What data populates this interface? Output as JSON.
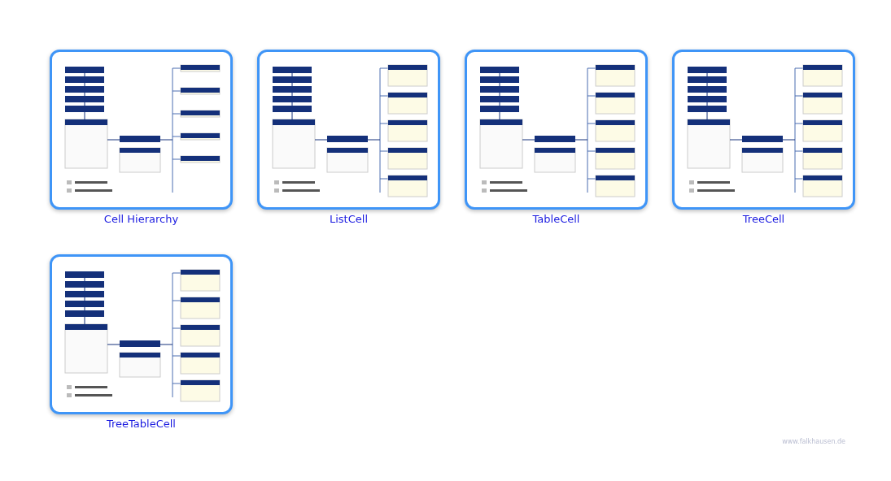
{
  "gallery": [
    {
      "caption": "Cell Hierarchy"
    },
    {
      "caption": "ListCell"
    },
    {
      "caption": "TableCell"
    },
    {
      "caption": "TreeCell"
    },
    {
      "caption": "TreeTableCell"
    }
  ],
  "footer": {
    "site": "www.falkhausen.de"
  }
}
